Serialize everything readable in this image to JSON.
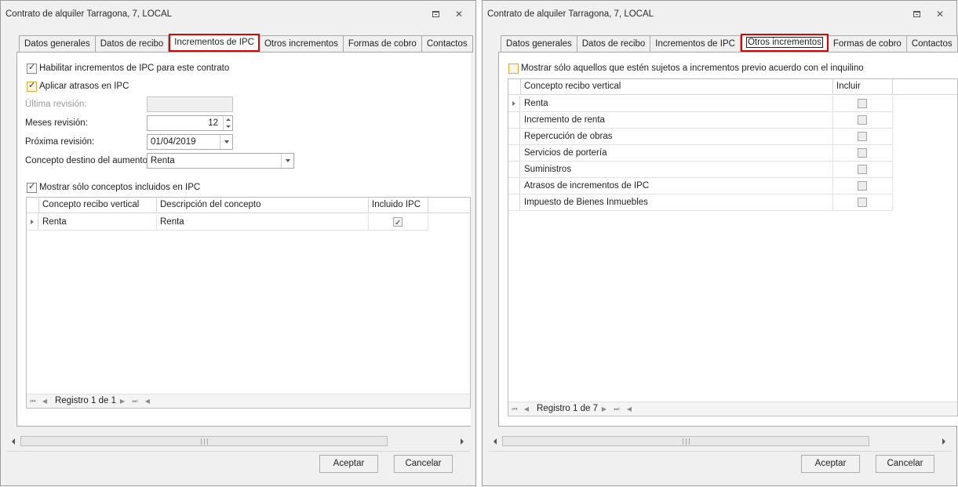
{
  "window1": {
    "title": "Contrato de alquiler Tarragona, 7, LOCAL",
    "tabs": [
      "Datos generales",
      "Datos de recibo",
      "Incrementos de IPC",
      "Otros incrementos",
      "Formas de cobro",
      "Contactos"
    ],
    "active_tab": "Incrementos de IPC",
    "enable_ipc": {
      "label": "Habilitar incrementos de IPC para este contrato",
      "checked": true
    },
    "apply_arrears": {
      "label": "Aplicar atrasos en IPC",
      "checked": true
    },
    "last_revision": {
      "label": "Última revisión:",
      "value": ""
    },
    "months_revision": {
      "label": "Meses revisión:",
      "value": "12"
    },
    "next_revision": {
      "label": "Próxima revisión:",
      "value": "01/04/2019"
    },
    "target_concept": {
      "label": "Concepto destino del aumento:",
      "value": "Renta"
    },
    "show_included": {
      "label": "Mostrar sólo conceptos incluidos en IPC",
      "checked": true
    },
    "grid": {
      "columns": [
        "Concepto recibo vertical",
        "Descripción del concepto",
        "Incluido IPC"
      ],
      "rows": [
        {
          "concept": "Renta",
          "description": "Renta",
          "included": true
        }
      ]
    },
    "nav_text": "Registro 1 de 1",
    "ok": "Aceptar",
    "cancel": "Cancelar"
  },
  "window2": {
    "title": "Contrato de alquiler Tarragona, 7, LOCAL",
    "tabs": [
      "Datos generales",
      "Datos de recibo",
      "Incrementos de IPC",
      "Otros incrementos",
      "Formas de cobro",
      "Contactos"
    ],
    "active_tab": "Otros incrementos",
    "only_subject": {
      "label": "Mostrar sólo aquellos que estén sujetos a incrementos previo acuerdo con el inquilino",
      "checked": false
    },
    "grid": {
      "columns": [
        "Concepto recibo vertical",
        "Incluir"
      ],
      "rows": [
        {
          "concept": "Renta",
          "include": false
        },
        {
          "concept": "Incremento de renta",
          "include": false
        },
        {
          "concept": "Repercución de obras",
          "include": false
        },
        {
          "concept": "Servicios de portería",
          "include": false
        },
        {
          "concept": "Suministros",
          "include": false
        },
        {
          "concept": "Atrasos de incrementos de IPC",
          "include": false
        },
        {
          "concept": "Impuesto de Bienes Inmuebles",
          "include": false
        }
      ]
    },
    "nav_text": "Registro 1 de 7",
    "ok": "Aceptar",
    "cancel": "Cancelar"
  },
  "colors": {
    "highlight": "#e00000",
    "orange_checkbox": "#e8a33c"
  }
}
